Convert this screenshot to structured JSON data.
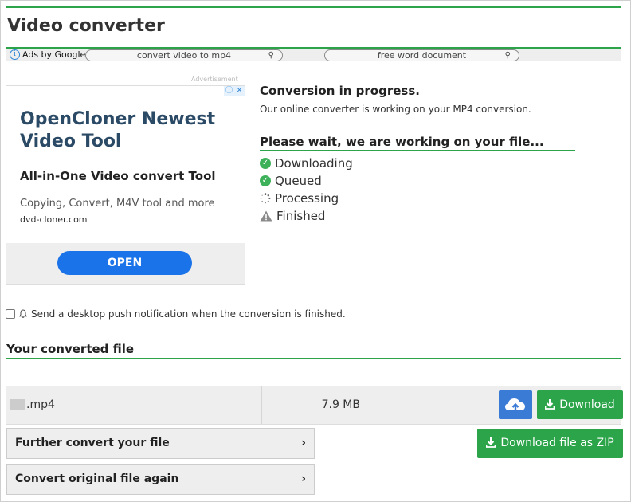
{
  "header": {
    "title": "Video converter"
  },
  "adbar": {
    "ads_by": "Ads by Google",
    "pill1": "convert video to mp4",
    "pill2": "free word document"
  },
  "ad": {
    "label": "Advertisement",
    "headline": "OpenCloner Newest Video Tool",
    "subtitle": "All-in-One Video convert Tool",
    "description": "Copying, Convert, M4V tool and more",
    "url": "dvd-cloner.com",
    "cta": "OPEN"
  },
  "status": {
    "title": "Conversion in progress.",
    "description": "Our online converter is working on your MP4 conversion.",
    "wait_title": "Please wait, we are working on your file...",
    "steps": [
      {
        "label": "Downloading",
        "icon": "check-icon"
      },
      {
        "label": "Queued",
        "icon": "check-icon"
      },
      {
        "label": "Processing",
        "icon": "spinner-icon"
      },
      {
        "label": "Finished",
        "icon": "warning-icon"
      }
    ]
  },
  "notify": {
    "label": "Send a desktop push notification when the conversion is finished."
  },
  "converted": {
    "title": "Your converted file",
    "file_ext": ".mp4",
    "size": "7.9 MB",
    "download": "Download",
    "download_zip": "Download file as ZIP"
  },
  "actions": {
    "further": "Further convert your file",
    "again": "Convert original file again",
    "chevron": "›"
  },
  "colors": {
    "accent": "#2ca44a",
    "blue": "#3a7bd5",
    "ad_button": "#1a73e8"
  }
}
